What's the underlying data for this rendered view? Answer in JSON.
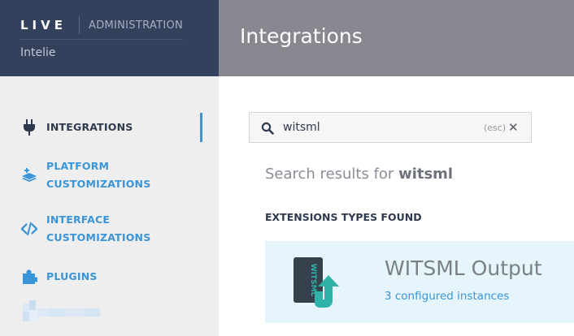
{
  "brand": {
    "logo": "LIVE",
    "section": "ADMINISTRATION",
    "organization": "Intelie"
  },
  "header": {
    "title": "Integrations"
  },
  "sidebar": {
    "items": [
      {
        "label": "INTEGRATIONS",
        "icon": "plug-icon",
        "active": true
      },
      {
        "label": "PLATFORM\nCUSTOMIZATIONS",
        "icon": "layers-icon",
        "active": false
      },
      {
        "label": "INTERFACE\nCUSTOMIZATIONS",
        "icon": "code-icon",
        "active": false
      },
      {
        "label": "PLUGINS",
        "icon": "puzzle-icon",
        "active": false
      }
    ]
  },
  "search": {
    "value": "witsml",
    "esc_hint": "(esc)",
    "clear_glyph": "✕"
  },
  "results": {
    "prefix": "Search results for ",
    "query": "witsml",
    "section_title": "EXTENSIONS TYPES FOUND",
    "items": [
      {
        "title": "WITSML Output",
        "subtitle": "3 configured instances",
        "icon": "witsml-output-icon",
        "icon_text": "WITSML"
      }
    ]
  },
  "colors": {
    "brand_bg": "#34415c",
    "topbar_bg": "#878890",
    "sidebar_bg": "#eeeeee",
    "accent": "#3a95d8",
    "card_bg": "#e6f4fb",
    "witsml_teal": "#2fb3a8"
  }
}
